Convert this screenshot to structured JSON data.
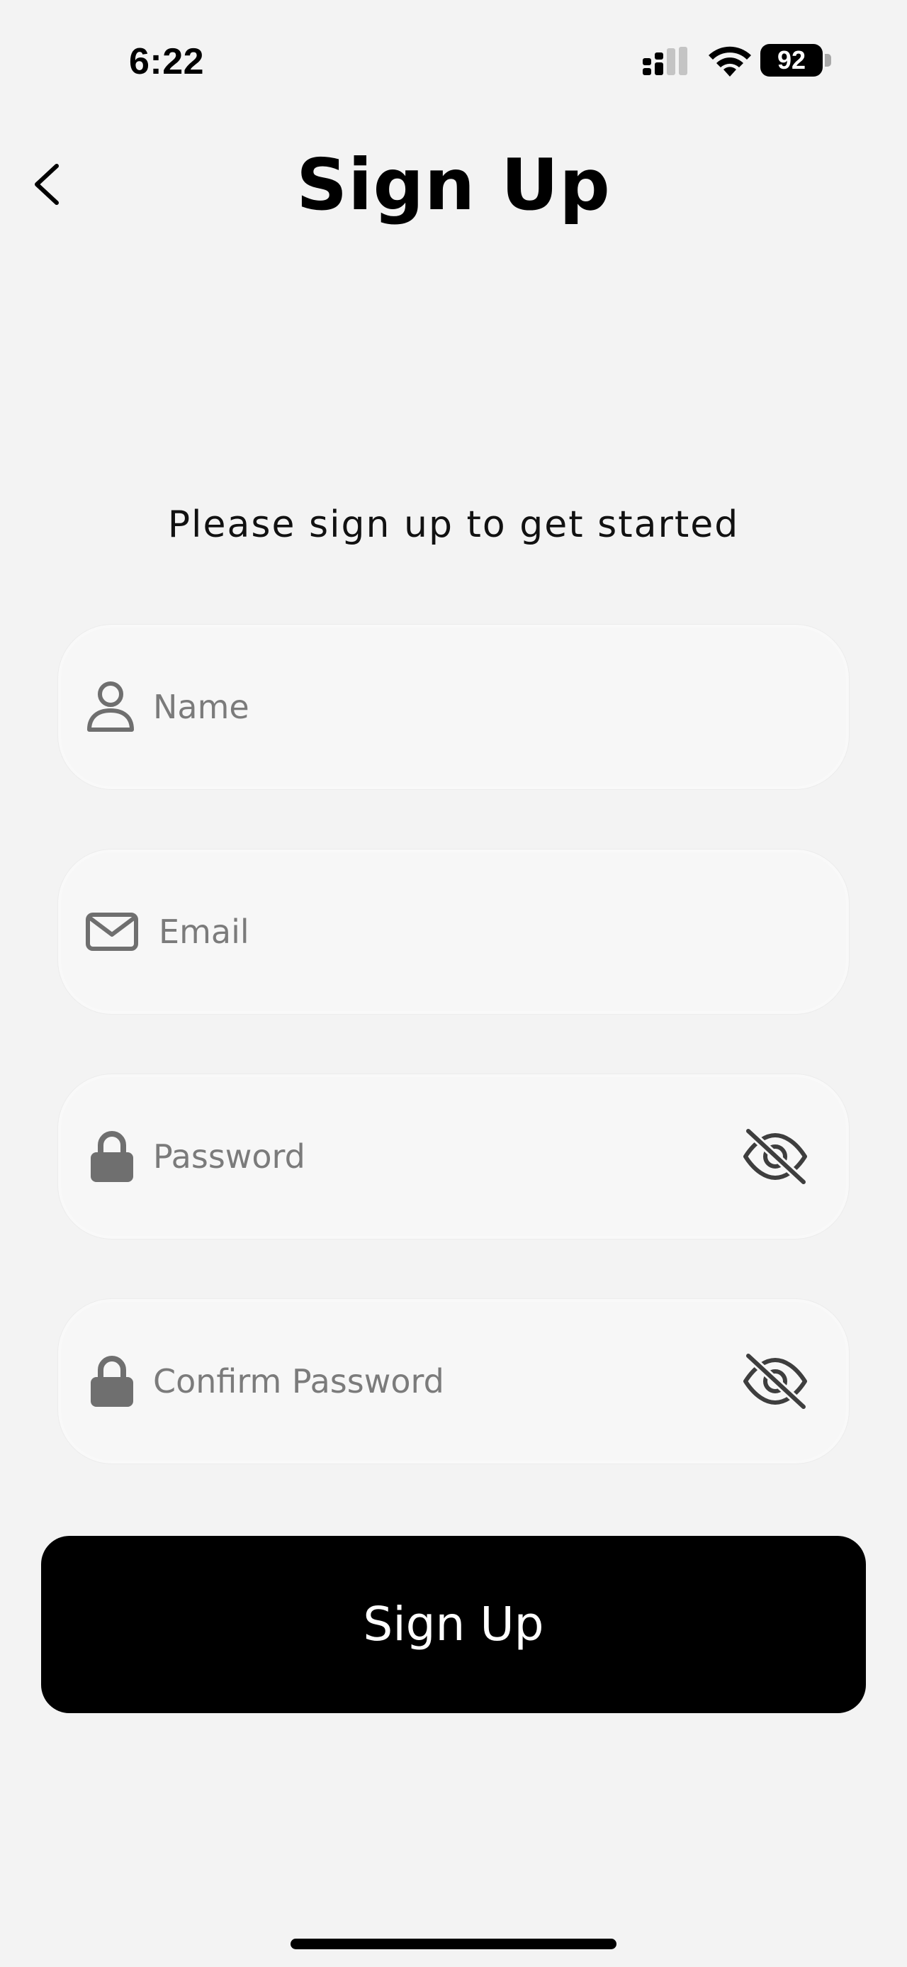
{
  "status_bar": {
    "time": "6:22",
    "battery": "92"
  },
  "header": {
    "title": "Sign Up",
    "back_icon": "chevron-left-icon"
  },
  "subtitle": "Please sign up to get started",
  "form": {
    "name_placeholder": "Name",
    "email_placeholder": "Email",
    "password_placeholder": "Password",
    "confirm_password_placeholder": "Confirm Password",
    "icons": {
      "name": "user-icon",
      "email": "mail-icon",
      "password": "lock-icon",
      "visibility": "eye-off-icon"
    }
  },
  "signup_button": {
    "label": "Sign Up"
  },
  "colors": {
    "background": "#f3f3f3",
    "field_background": "#f7f7f7",
    "button_background": "#000000",
    "icon_grey": "#6f6f6f"
  }
}
